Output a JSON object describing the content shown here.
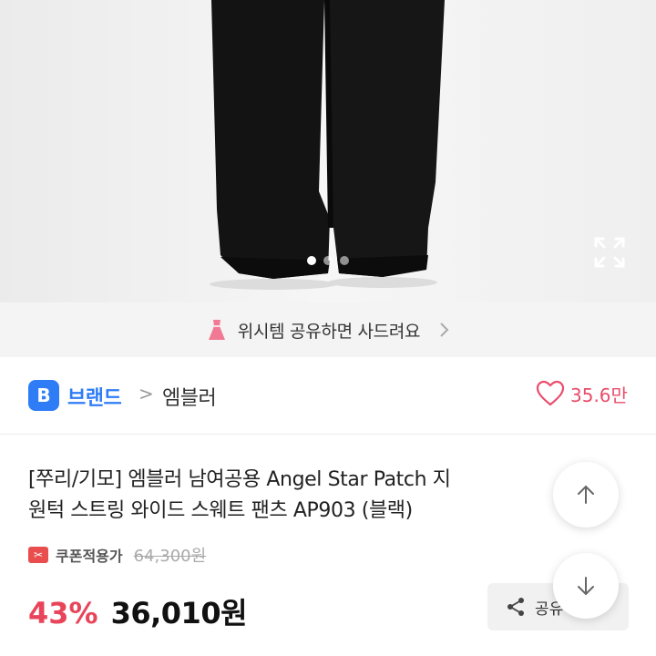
{
  "banner": {
    "text": "위시템 공유하면 사드려요",
    "icon": "dress-icon"
  },
  "brand": {
    "badge": "B",
    "label": "브랜드",
    "separator": ">",
    "name": "엠블러"
  },
  "likes": {
    "count": "35.6만"
  },
  "product": {
    "title_line1": "[쭈리/기모] 엠블러 남여공용 Angel Star Patch 지",
    "title_line2": "원턱 스트링 와이드  스웨트 팬츠 AP903 (블랙)",
    "coupon_label": "쿠폰적용가",
    "original_price": "64,300원",
    "discount": "43%",
    "price": "36,010원"
  },
  "share": {
    "label": "공유"
  },
  "image_pager": {
    "total": 3,
    "current": 1
  },
  "colors": {
    "accent_blue": "#2f7df6",
    "accent_red": "#e8455a"
  }
}
